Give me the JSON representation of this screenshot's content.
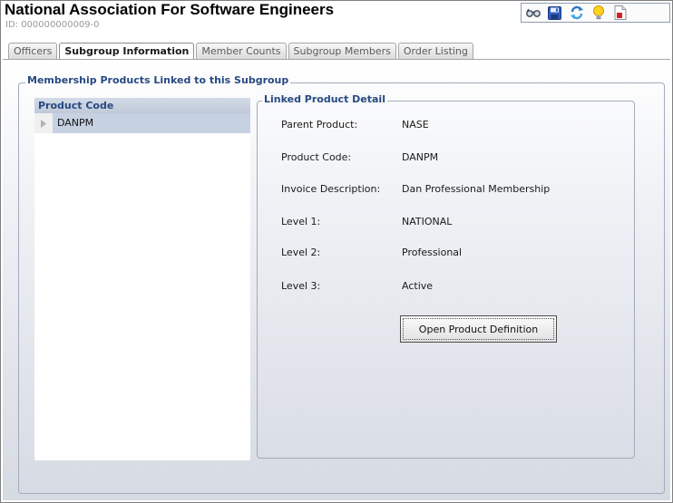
{
  "header": {
    "title": "National Association For Software Engineers",
    "id_text": "ID: 000000000009-0"
  },
  "toolbar": {
    "icons": [
      "glasses-icon",
      "save-icon",
      "refresh-icon",
      "lightbulb-icon",
      "report-icon"
    ]
  },
  "tabs": [
    {
      "label": "Officers",
      "active": false
    },
    {
      "label": "Subgroup Information",
      "active": true
    },
    {
      "label": "Member Counts",
      "active": false
    },
    {
      "label": "Subgroup Members",
      "active": false
    },
    {
      "label": "Order Listing",
      "active": false
    }
  ],
  "membership_group": {
    "title": "Membership Products Linked to this Subgroup",
    "column_header": "Product Code",
    "rows": [
      "DANPM"
    ]
  },
  "detail": {
    "title": "Linked Product Detail",
    "fields": [
      {
        "label": "Parent Product:",
        "value": "NASE"
      },
      {
        "label": "Product Code:",
        "value": "DANPM"
      },
      {
        "label": "Invoice Description:",
        "value": "Dan Professional Membership"
      },
      {
        "label": "Level 1:",
        "value": "NATIONAL"
      },
      {
        "label": "Level 2:",
        "value": "Professional"
      },
      {
        "label": "Level 3:",
        "value": "Active"
      }
    ],
    "button_label": "Open Product Definition"
  },
  "colors": {
    "group_title": "#274a82",
    "row_selected": "#c6d1e2",
    "header_id": "#9a9a9a"
  }
}
